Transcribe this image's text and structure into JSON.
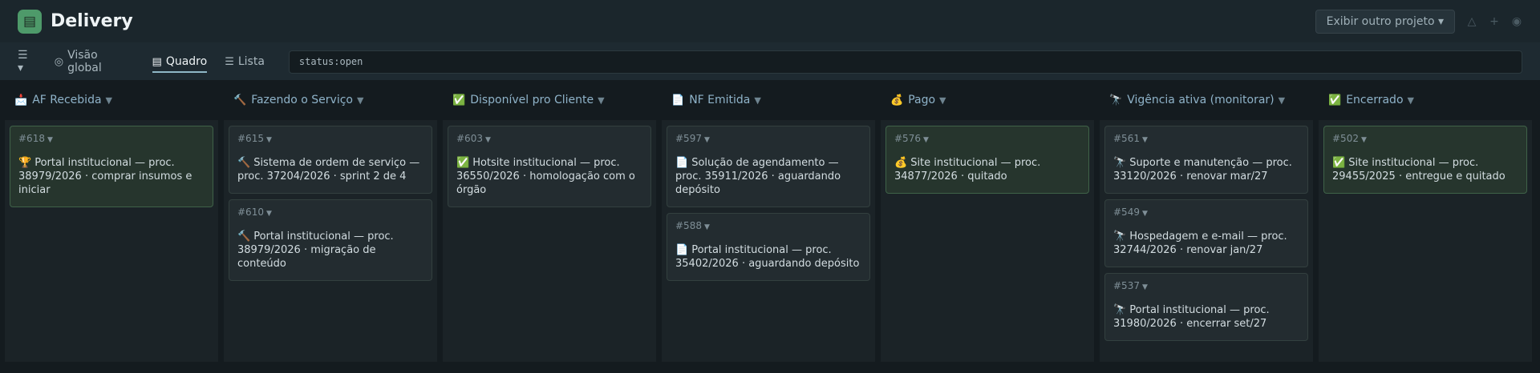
{
  "header": {
    "app_icon": "clipboard-icon",
    "title": "Delivery",
    "project_button": "Exibir outro projeto ▾",
    "icons": [
      "alert-icon",
      "plus-icon",
      "user-icon"
    ]
  },
  "toolbar": {
    "menu": "☰ ▾",
    "tabs": [
      {
        "icon": "◎",
        "label": "Visão global"
      },
      {
        "icon": "▤",
        "label": "Quadro"
      },
      {
        "icon": "☰",
        "label": "Lista"
      }
    ],
    "filter_value": "status:open"
  },
  "columns": [
    {
      "icon": "📩",
      "title": "AF Recebida",
      "cards": [
        {
          "id": "#618",
          "icon": "🏆",
          "text": "Portal institucional — proc. 38979/2026 · comprar insumos e iniciar",
          "highlight": true
        }
      ]
    },
    {
      "icon": "🔨",
      "title": "Fazendo o Serviço",
      "cards": [
        {
          "id": "#615",
          "icon": "🔨",
          "text": "Sistema de ordem de serviço — proc. 37204/2026 · sprint 2 de 4"
        },
        {
          "id": "#610",
          "icon": "🔨",
          "text": "Portal institucional — proc. 38979/2026 · migração de conteúdo"
        }
      ]
    },
    {
      "icon": "✅",
      "title": "Disponível pro Cliente",
      "cards": [
        {
          "id": "#603",
          "icon": "✅",
          "text": "Hotsite institucional — proc. 36550/2026 · homologação com o órgão"
        }
      ]
    },
    {
      "icon": "📄",
      "title": "NF Emitida",
      "cards": [
        {
          "id": "#597",
          "icon": "📄",
          "text": "Solução de agendamento — proc. 35911/2026 · aguardando depósito"
        },
        {
          "id": "#588",
          "icon": "📄",
          "text": "Portal institucional — proc. 35402/2026 · aguardando depósito"
        }
      ]
    },
    {
      "icon": "💰",
      "title": "Pago",
      "cards": [
        {
          "id": "#576",
          "icon": "💰",
          "text": "Site institucional — proc. 34877/2026 · quitado",
          "highlight": true
        }
      ]
    },
    {
      "icon": "🔭",
      "title": "Vigência ativa (monitorar)",
      "cards": [
        {
          "id": "#561",
          "icon": "🔭",
          "text": "Suporte e manutenção — proc. 33120/2026 · renovar mar/27"
        },
        {
          "id": "#549",
          "icon": "🔭",
          "text": "Hospedagem e e-mail — proc. 32744/2026 · renovar jan/27"
        },
        {
          "id": "#537",
          "icon": "🔭",
          "text": "Portal institucional — proc. 31980/2026 · encerrar set/27"
        }
      ]
    },
    {
      "icon": "✅",
      "title": "Encerrado",
      "cards": [
        {
          "id": "#502",
          "icon": "✅",
          "text": "Site institucional — proc. 29455/2025 · entregue e quitado",
          "highlight": true
        }
      ]
    }
  ],
  "colors": {
    "accent": "#8fb7c6",
    "highlight_card": "#26352d",
    "logo": "#4e9a6a"
  }
}
